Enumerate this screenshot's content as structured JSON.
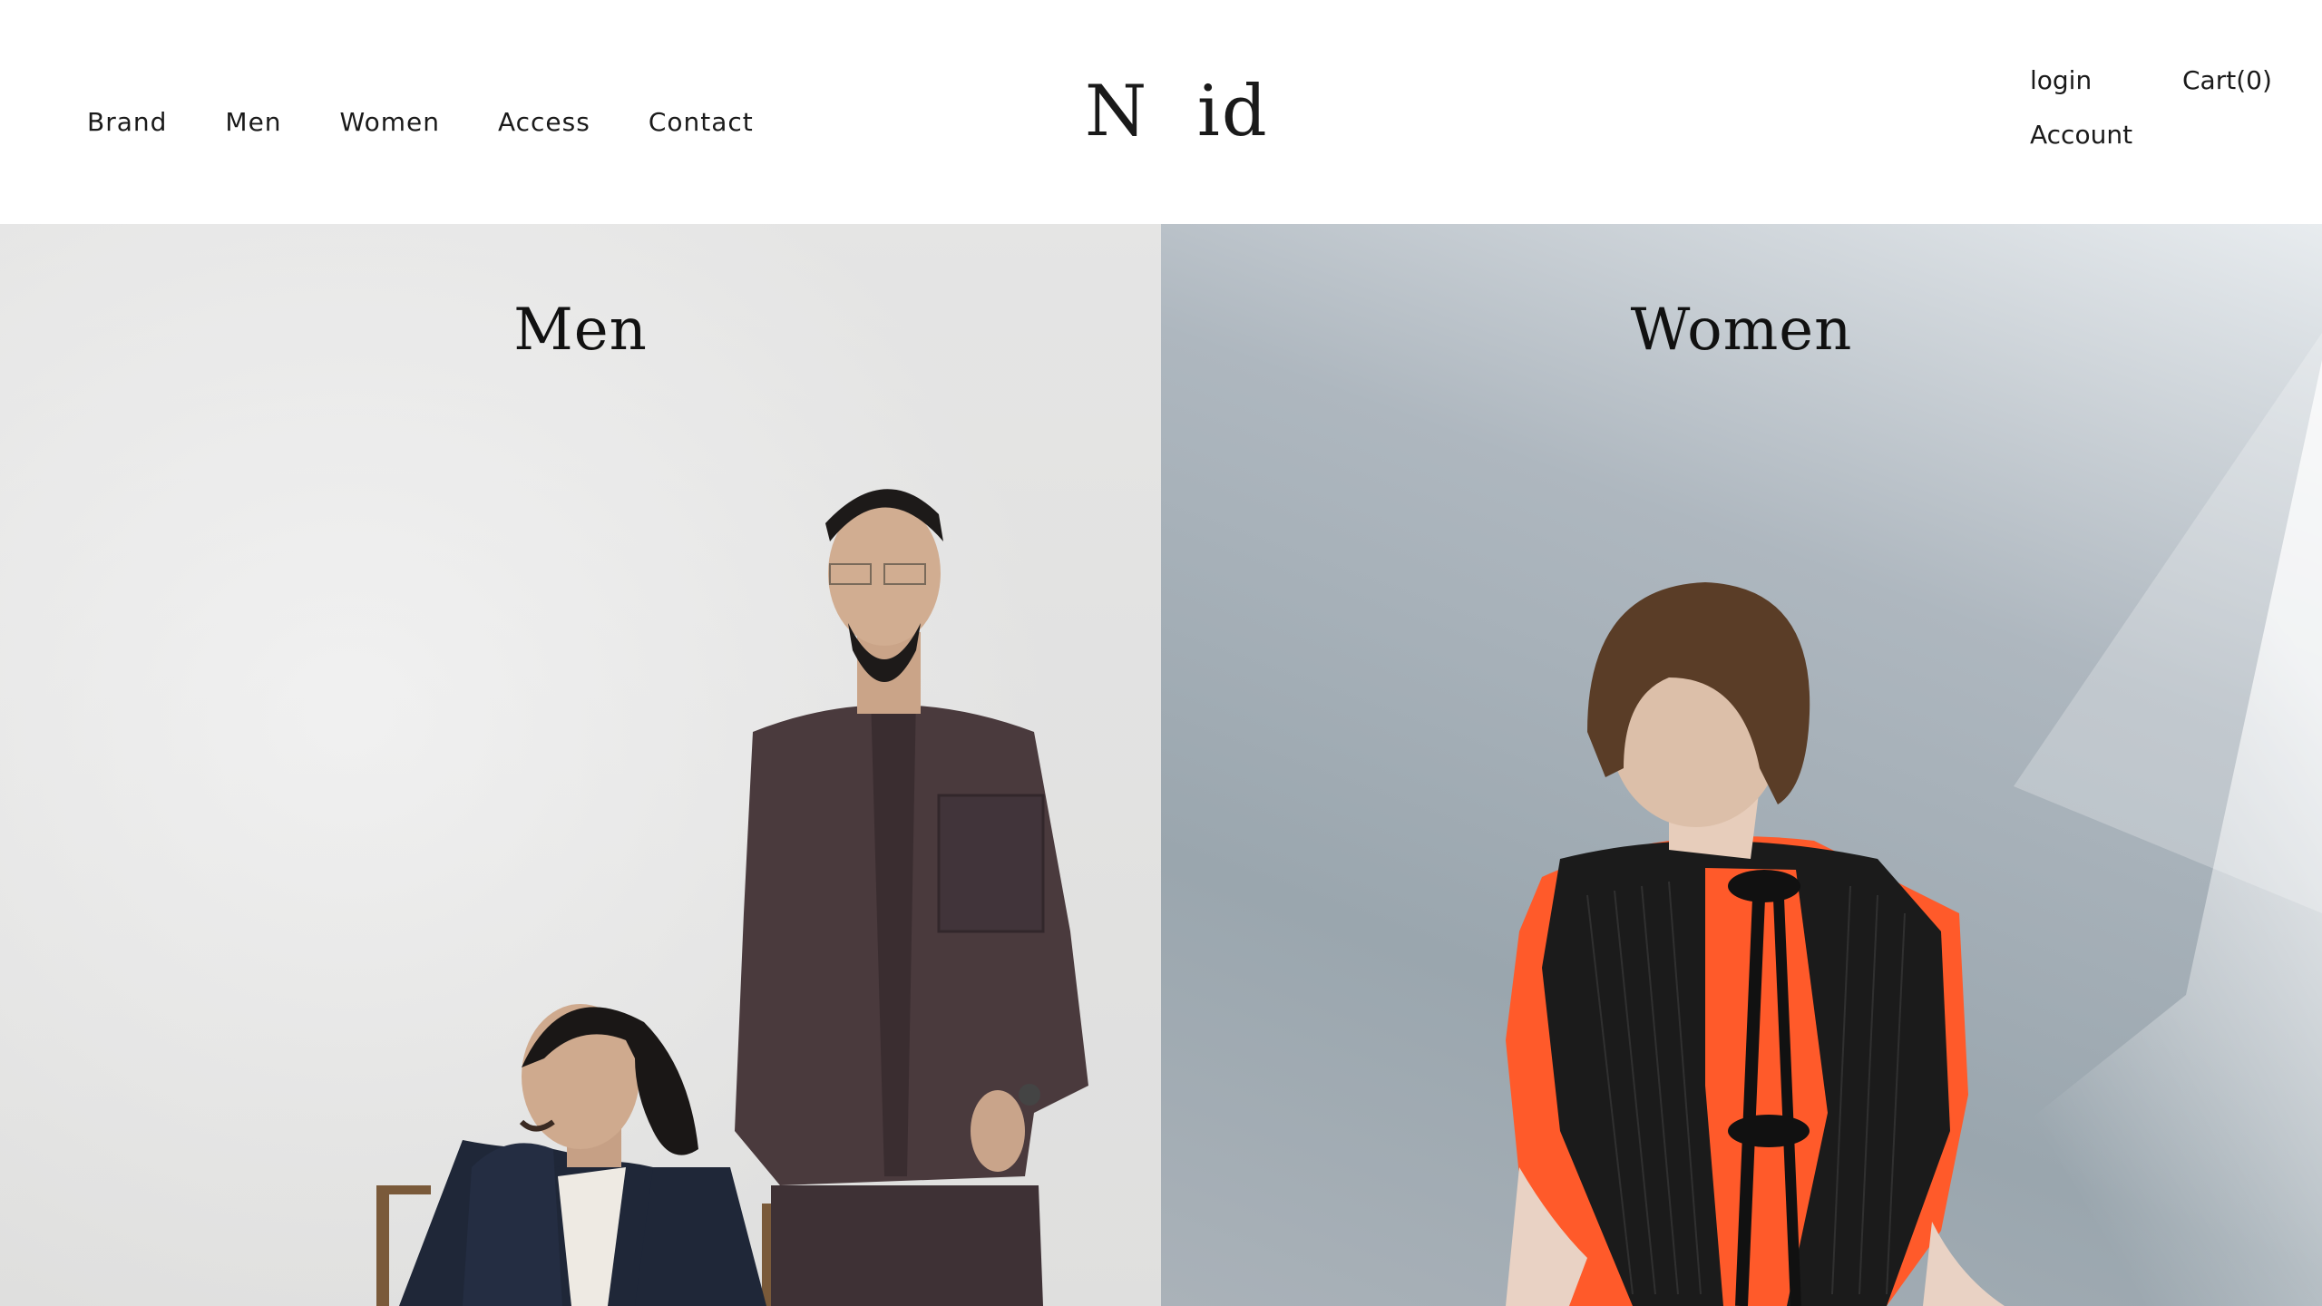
{
  "header": {
    "nav": [
      "Brand",
      "Men",
      "Women",
      "Access",
      "Contact"
    ],
    "logo": "N  id",
    "account_links": {
      "login": "login",
      "cart": "Cart(0)",
      "account": "Account"
    }
  },
  "panels": {
    "men": {
      "title": "Men"
    },
    "women": {
      "title": "Women"
    }
  },
  "colors": {
    "text": "#1a1a1a",
    "background": "#ffffff",
    "men_wall": "#ececec",
    "women_wall": "#aeb7bf",
    "men_jacket_navy": "#1f2738",
    "men_shirt_plum": "#4a3a3d",
    "women_top_orange": "#ff5a2a",
    "women_vest_black": "#1b1b1b"
  }
}
